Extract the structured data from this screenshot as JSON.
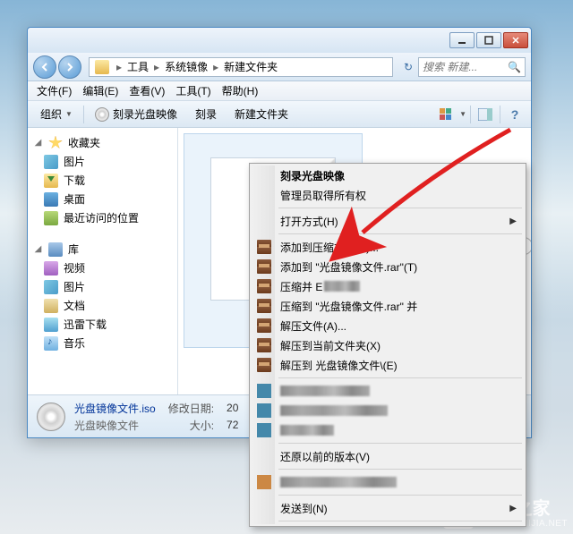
{
  "breadcrumb": {
    "seg1": "工具",
    "seg2": "系统镜像",
    "seg3": "新建文件夹"
  },
  "search": {
    "placeholder": "搜索 新建..."
  },
  "menu": {
    "file": "文件(F)",
    "edit": "编辑(E)",
    "view": "查看(V)",
    "tools": "工具(T)",
    "help": "帮助(H)"
  },
  "toolbar": {
    "org": "组织",
    "burn_image": "刻录光盘映像",
    "burn": "刻录",
    "newfolder": "新建文件夹"
  },
  "sidebar": {
    "fav": "收藏夹",
    "fav_items": [
      "图片",
      "下载",
      "桌面",
      "最近访问的位置"
    ],
    "lib": "库",
    "lib_items": [
      "视频",
      "图片",
      "文档",
      "迅雷下载",
      "音乐"
    ]
  },
  "detail": {
    "filename": "光盘镜像文件.iso",
    "filetype": "光盘映像文件",
    "mod_label": "修改日期:",
    "mod_val": "20",
    "size_label": "大小:",
    "size_val": "72"
  },
  "context": {
    "burn": "刻录光盘映像",
    "admin": "管理员取得所有权",
    "openwith": "打开方式(H)",
    "addarchive": "添加到压缩文件(A)...",
    "addto_rar": "添加到 \"光盘镜像文件.rar\"(T)",
    "compress_and": "压缩并 E",
    "compress_to_and": "压缩到 \"光盘镜像文件.rar\" 并",
    "extract": "解压文件(A)...",
    "extract_here": "解压到当前文件夹(X)",
    "extract_to": "解压到 光盘镜像文件\\(E)",
    "restore": "还原以前的版本(V)",
    "sendto": "发送到(N)"
  },
  "watermark": {
    "name": "系统之家",
    "url": "XITONGZHIJIA.NET"
  }
}
